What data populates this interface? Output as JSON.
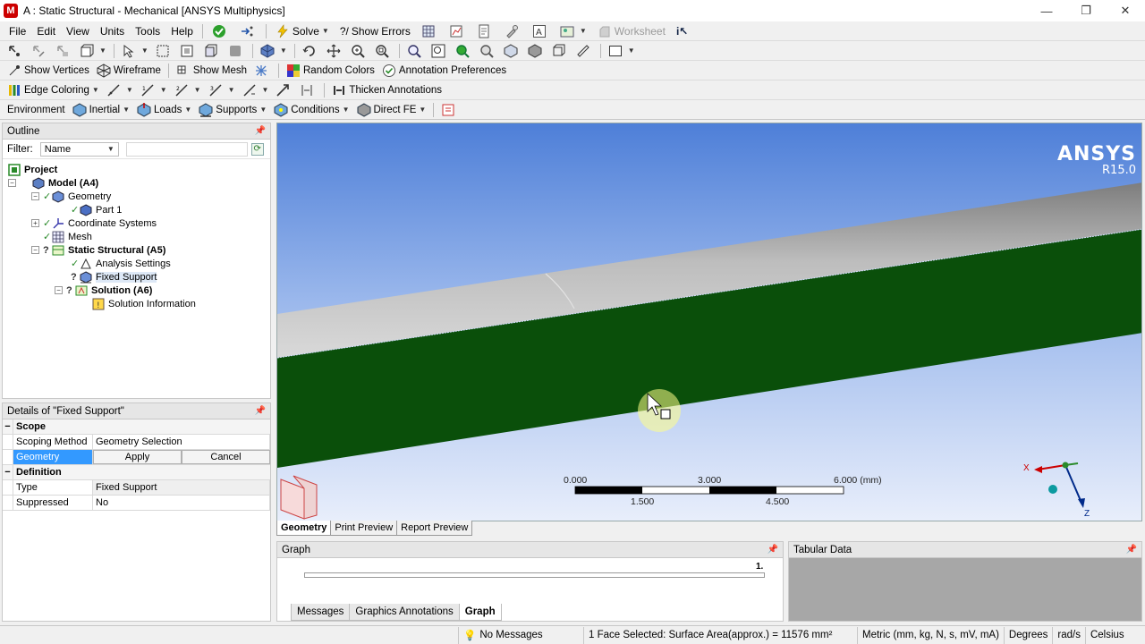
{
  "window": {
    "title": "A : Static Structural - Mechanical [ANSYS Multiphysics]",
    "app_icon_letter": "M",
    "controls": [
      "—",
      "❐",
      "✕"
    ]
  },
  "menubar": {
    "items": [
      "File",
      "Edit",
      "View",
      "Units",
      "Tools",
      "Help"
    ],
    "solve_label": "Solve",
    "show_errors_label": "Show Errors",
    "worksheet_label": "Worksheet"
  },
  "toolbar3": {
    "show_vertices": "Show Vertices",
    "wireframe": "Wireframe",
    "show_mesh": "Show Mesh",
    "random_colors": "Random Colors",
    "annotation_prefs": "Annotation Preferences"
  },
  "toolbar4": {
    "edge_coloring": "Edge Coloring",
    "thicken_annotations": "Thicken Annotations"
  },
  "toolbar5": {
    "environment": "Environment",
    "inertial": "Inertial",
    "loads": "Loads",
    "supports": "Supports",
    "conditions": "Conditions",
    "direct_fe": "Direct FE"
  },
  "outline": {
    "title": "Outline",
    "filter_label": "Filter:",
    "filter_value": "Name",
    "items": [
      {
        "label": "Project",
        "bold": true
      },
      {
        "label": "Model (A4)",
        "bold": true
      },
      {
        "label": "Geometry",
        "bold": false
      },
      {
        "label": "Part 1",
        "bold": false
      },
      {
        "label": "Coordinate Systems",
        "bold": false
      },
      {
        "label": "Mesh",
        "bold": false
      },
      {
        "label": "Static Structural (A5)",
        "bold": true
      },
      {
        "label": "Analysis Settings",
        "bold": false
      },
      {
        "label": "Fixed Support",
        "bold": false
      },
      {
        "label": "Solution (A6)",
        "bold": true
      },
      {
        "label": "Solution Information",
        "bold": false
      }
    ]
  },
  "details": {
    "title": "Details of \"Fixed Support\"",
    "scope_section": "Scope",
    "scoping_method_key": "Scoping Method",
    "scoping_method_value": "Geometry Selection",
    "geometry_key": "Geometry",
    "apply_label": "Apply",
    "cancel_label": "Cancel",
    "definition_section": "Definition",
    "type_key": "Type",
    "type_value": "Fixed Support",
    "suppressed_key": "Suppressed",
    "suppressed_value": "No",
    "expand_minus": "−"
  },
  "viewport": {
    "brand_name": "ANSYS",
    "brand_version": "R15.0",
    "scale_top": [
      "0.000",
      "3.000",
      "6.000 (mm)"
    ],
    "scale_bottom": [
      "1.500",
      "4.500"
    ],
    "axis_x": "X",
    "axis_z": "Z",
    "body_color": "#0a4f0a",
    "pipe_color": "#9a9a9a",
    "tabs": [
      "Geometry",
      "Print Preview",
      "Report Preview"
    ]
  },
  "graph": {
    "title": "Graph",
    "marker": "1.",
    "tabs": [
      "Messages",
      "Graphics Annotations",
      "Graph"
    ]
  },
  "tabular": {
    "title": "Tabular Data"
  },
  "statusbar": {
    "messages": "No Messages",
    "selection": "1 Face Selected: Surface Area(approx.) = 11576 mm²",
    "units": "Metric (mm, kg, N, s, mV, mA)",
    "angle": "Degrees",
    "rot_velocity": "rad/s",
    "temperature": "Celsius"
  }
}
